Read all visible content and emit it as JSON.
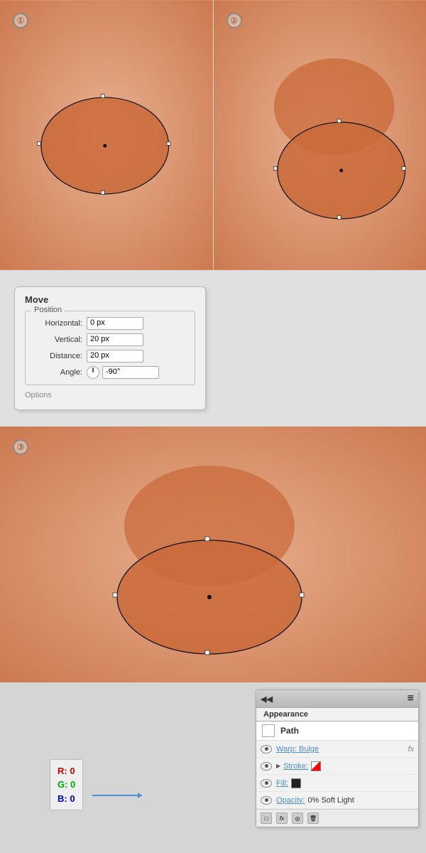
{
  "panels": {
    "step1_num": "①",
    "step2_num": "②",
    "step3_num": "③"
  },
  "move_dialog": {
    "title": "Move",
    "section_label": "Position",
    "horizontal_label": "Horizontal:",
    "horizontal_value": "0 px",
    "vertical_label": "Vertical:",
    "vertical_value": "20 px",
    "distance_label": "Distance:",
    "distance_value": "20 px",
    "angle_label": "Angle:",
    "angle_value": "-90°",
    "options_label": "Options"
  },
  "appearance": {
    "panel_title": "Appearance",
    "arrows": "◀◀",
    "menu": "≡",
    "path_label": "Path",
    "warp_label": "Warp: Bulge",
    "fx_label": "fx",
    "stroke_label": "Stroke:",
    "fill_label": "Fill:",
    "opacity_label": "Opacity:",
    "opacity_value": "0% Soft Light"
  },
  "rgb": {
    "r_label": "R: 0",
    "g_label": "G: 0",
    "b_label": "B: 0"
  }
}
